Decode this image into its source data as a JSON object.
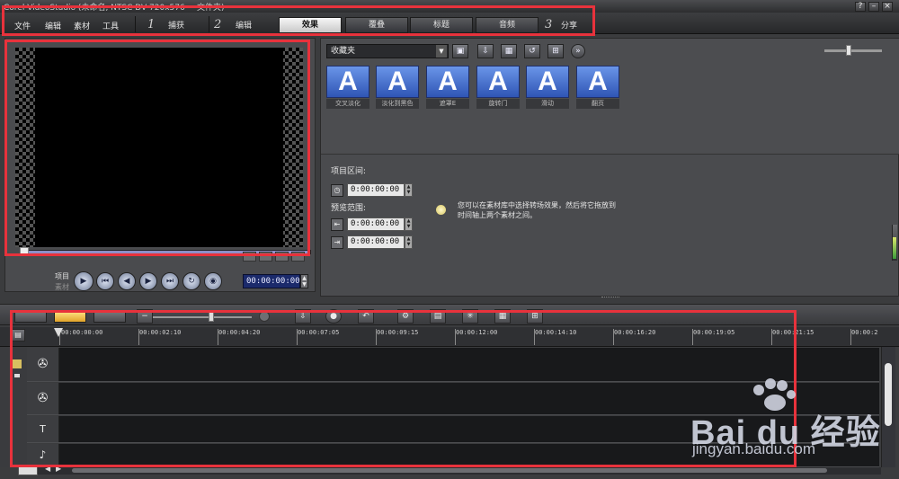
{
  "window": {
    "title": "Corel VideoStudio  (未命名, NTSC DV 720x576 ~ 文件夹)",
    "help_label": "?",
    "minimize_label": "–",
    "close_label": "×"
  },
  "menu": {
    "items": [
      {
        "label": "文件"
      },
      {
        "label": "编辑"
      },
      {
        "label": "素材"
      },
      {
        "label": "工具"
      }
    ]
  },
  "steps": [
    {
      "number": "1",
      "label": "捕获"
    },
    {
      "number": "2",
      "label": "编辑"
    },
    {
      "number": "3",
      "label": "分享"
    }
  ],
  "subtabs": [
    {
      "label": "效果",
      "active": true
    },
    {
      "label": "覆叠",
      "active": false
    },
    {
      "label": "标题",
      "active": false
    },
    {
      "label": "音频",
      "active": false
    }
  ],
  "preview": {
    "mode_project": "项目",
    "mode_clip": "素材",
    "timecode": "00:00:00:00",
    "controls": [
      "play",
      "home",
      "previous-frame",
      "next-frame",
      "end",
      "repeat",
      "volume"
    ]
  },
  "library": {
    "folder_selected": "收藏夹",
    "transitions": [
      {
        "caption": "交叉淡化",
        "glyph": "A"
      },
      {
        "caption": "淡化到黑色",
        "glyph": "A"
      },
      {
        "caption": "遮罩E",
        "glyph": "A"
      },
      {
        "caption": "旋转门",
        "glyph": "A"
      },
      {
        "caption": "滑动",
        "glyph": "A"
      },
      {
        "caption": "翻页",
        "glyph": "A"
      }
    ],
    "properties": {
      "duration_label": "项目区间:",
      "duration_value": "0:00:00:00",
      "preview_range_label": "预览范围:",
      "range_start": "0:00:00:00",
      "range_end": "0:00:00:00"
    },
    "hint": "您可以在素材库中选择转场效果，然后将它拖放到时间轴上两个素材之间。"
  },
  "timeline": {
    "ruler_ticks": [
      "00:00:00:00",
      "00:00:02:10",
      "00:00:04:20",
      "00:00:07:05",
      "00:00:09:15",
      "00:00:12:00",
      "00:00:14:10",
      "00:00:16:20",
      "00:00:19:05",
      "00:00:21:15",
      "00:00:2"
    ],
    "tracks": [
      {
        "name": "video-track",
        "icon": "film-reel-icon"
      },
      {
        "name": "overlay-track",
        "icon": "film-reel-icon"
      },
      {
        "name": "title-track",
        "icon": "title-icon",
        "glyph": "T"
      },
      {
        "name": "audio-track",
        "icon": "note-icon"
      }
    ]
  },
  "watermark": {
    "brand": "Bai du 经验",
    "url": "jingyan.baidu.com"
  },
  "colors": {
    "highlight": "#e8323c",
    "active_tab": "#f6f6f6",
    "thumb_blue": "#4a72d0",
    "timecode_bg": "#1b2a6b"
  }
}
